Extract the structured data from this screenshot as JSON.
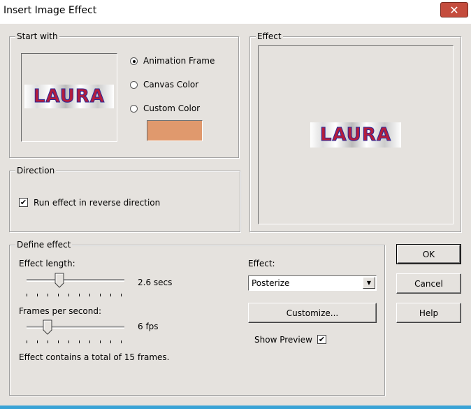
{
  "window": {
    "title": "Insert Image Effect",
    "close_label": "✕"
  },
  "start_with": {
    "legend": "Start with",
    "preview_text": "LAURA",
    "options": [
      {
        "label": "Animation Frame",
        "selected": true
      },
      {
        "label": "Canvas Color",
        "selected": false
      },
      {
        "label": "Custom Color",
        "selected": false
      }
    ],
    "custom_color": "#e0996d"
  },
  "effect_preview": {
    "legend": "Effect",
    "preview_text": "LAURA"
  },
  "direction": {
    "legend": "Direction",
    "reverse_label": "Run effect in reverse direction",
    "reverse_checked": true
  },
  "define_effect": {
    "legend": "Define effect",
    "length_label": "Effect length:",
    "length_value": "2.6 secs",
    "length_fraction": 0.32,
    "fps_label": "Frames per second:",
    "fps_value": "6 fps",
    "fps_fraction": 0.18,
    "summary": "Effect contains a total of 15 frames.",
    "effect_label": "Effect:",
    "effect_selected": "Posterize",
    "customize_label": "Customize...",
    "show_preview_label": "Show Preview",
    "show_preview_checked": true
  },
  "buttons": {
    "ok": "OK",
    "cancel": "Cancel",
    "help": "Help"
  },
  "icons": {
    "radio_selected": "radio-selected-icon",
    "checkmark": "checkmark-icon",
    "dropdown": "chevron-down-icon"
  }
}
